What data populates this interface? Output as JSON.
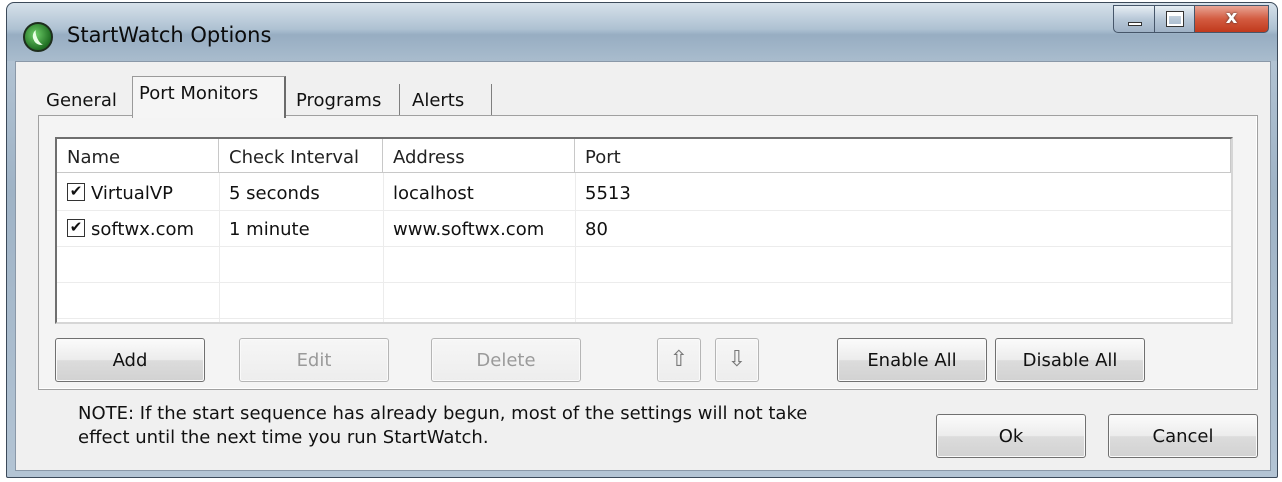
{
  "window": {
    "title": "StartWatch Options",
    "close_glyph": "x"
  },
  "tabs": [
    {
      "label": "General"
    },
    {
      "label": "Port Monitors"
    },
    {
      "label": "Programs"
    },
    {
      "label": "Alerts"
    }
  ],
  "table": {
    "columns": [
      "Name",
      "Check Interval",
      "Address",
      "Port"
    ],
    "rows": [
      {
        "checked": true,
        "name": "VirtualVP",
        "interval": "5 seconds",
        "address": "localhost",
        "port": "5513"
      },
      {
        "checked": true,
        "name": "softwx.com",
        "interval": "1 minute",
        "address": "www.softwx.com",
        "port": "80"
      }
    ]
  },
  "buttons": {
    "add": "Add",
    "edit": "Edit",
    "delete": "Delete",
    "move_up": "⇧",
    "move_down": "⇩",
    "enable_all": "Enable All",
    "disable_all": "Disable All",
    "ok": "Ok",
    "cancel": "Cancel"
  },
  "note": {
    "line1": "NOTE: If the start sequence has already begun, most of the settings will not take",
    "line2": "effect until the next time you run StartWatch."
  },
  "icons": {
    "app": "startwatch-logo-icon",
    "up": "arrow-up-icon",
    "down": "arrow-down-icon"
  },
  "checkmark": "✔"
}
